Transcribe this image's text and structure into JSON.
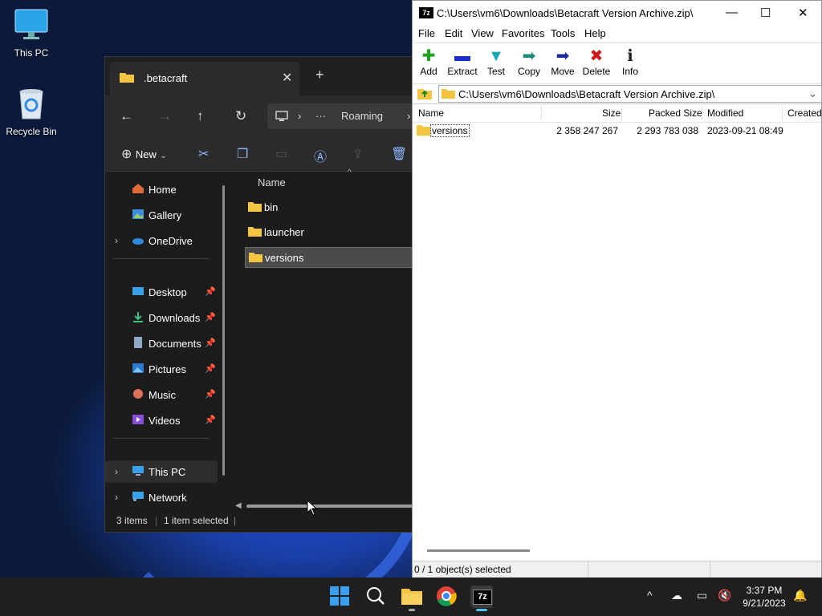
{
  "desktop": {
    "icons": [
      {
        "label": "This PC",
        "icon": "monitor-icon"
      },
      {
        "label": "Recycle Bin",
        "icon": "recycle-bin-icon"
      }
    ]
  },
  "explorer": {
    "tab_title": ".betacraft",
    "close_tab": "✕",
    "new_tab": "+",
    "nav": {
      "back": "←",
      "forward": "→",
      "up": "↑",
      "refresh": "↻",
      "chevron": "›",
      "ellipsis": "···",
      "breadcrumb": "Roaming"
    },
    "toolbar": {
      "new_label": "New"
    },
    "sidebar": [
      {
        "label": "Home",
        "icon": "home-icon"
      },
      {
        "label": "Gallery",
        "icon": "gallery-icon"
      },
      {
        "label": "OneDrive",
        "icon": "onedrive-icon"
      },
      {
        "label": "Desktop",
        "icon": "desktop-folder-icon"
      },
      {
        "label": "Downloads",
        "icon": "downloads-icon"
      },
      {
        "label": "Documents",
        "icon": "documents-icon"
      },
      {
        "label": "Pictures",
        "icon": "pictures-icon"
      },
      {
        "label": "Music",
        "icon": "music-icon"
      },
      {
        "label": "Videos",
        "icon": "videos-icon"
      },
      {
        "label": "This PC",
        "icon": "this-pc-icon"
      },
      {
        "label": "Network",
        "icon": "network-icon"
      }
    ],
    "column_name": "Name",
    "files": [
      {
        "label": "bin"
      },
      {
        "label": "launcher"
      },
      {
        "label": "versions"
      }
    ],
    "status": {
      "items": "3 items",
      "selected": "1 item selected"
    }
  },
  "sevenzip": {
    "title": "C:\\Users\\vm6\\Downloads\\Betacraft Version Archive.zip\\",
    "logo": "7z",
    "menu": [
      "File",
      "Edit",
      "View",
      "Favorites",
      "Tools",
      "Help"
    ],
    "toolbar": [
      {
        "label": "Add",
        "icon": "add-icon",
        "glyph": "✚",
        "color": "#1aa31a"
      },
      {
        "label": "Extract",
        "icon": "extract-icon",
        "glyph": "▬",
        "color": "#1a2fc7"
      },
      {
        "label": "Test",
        "icon": "test-icon",
        "glyph": "▼",
        "color": "#18a8b8"
      },
      {
        "label": "Copy",
        "icon": "copy-icon",
        "glyph": "➡",
        "color": "#1a8a7a"
      },
      {
        "label": "Move",
        "icon": "move-icon",
        "glyph": "➡",
        "color": "#1a2a9a"
      },
      {
        "label": "Delete",
        "icon": "delete-icon",
        "glyph": "✖",
        "color": "#d01818"
      },
      {
        "label": "Info",
        "icon": "info-icon",
        "glyph": "ℹ",
        "color": "#222222"
      }
    ],
    "address": "C:\\Users\\vm6\\Downloads\\Betacraft Version Archive.zip\\",
    "columns": [
      "Name",
      "Size",
      "Packed Size",
      "Modified",
      "Created"
    ],
    "rows": [
      {
        "name": "versions",
        "size": "2 358 247 267",
        "packed": "2 293 783 038",
        "modified": "2023-09-21 08:49",
        "created": ""
      }
    ],
    "status": "0 / 1 object(s) selected"
  },
  "taskbar": {
    "apps": [
      "start-icon",
      "search-icon",
      "file-explorer-icon",
      "chrome-icon",
      "7zip-icon"
    ],
    "time": "3:37 PM",
    "date": "9/21/2023"
  }
}
